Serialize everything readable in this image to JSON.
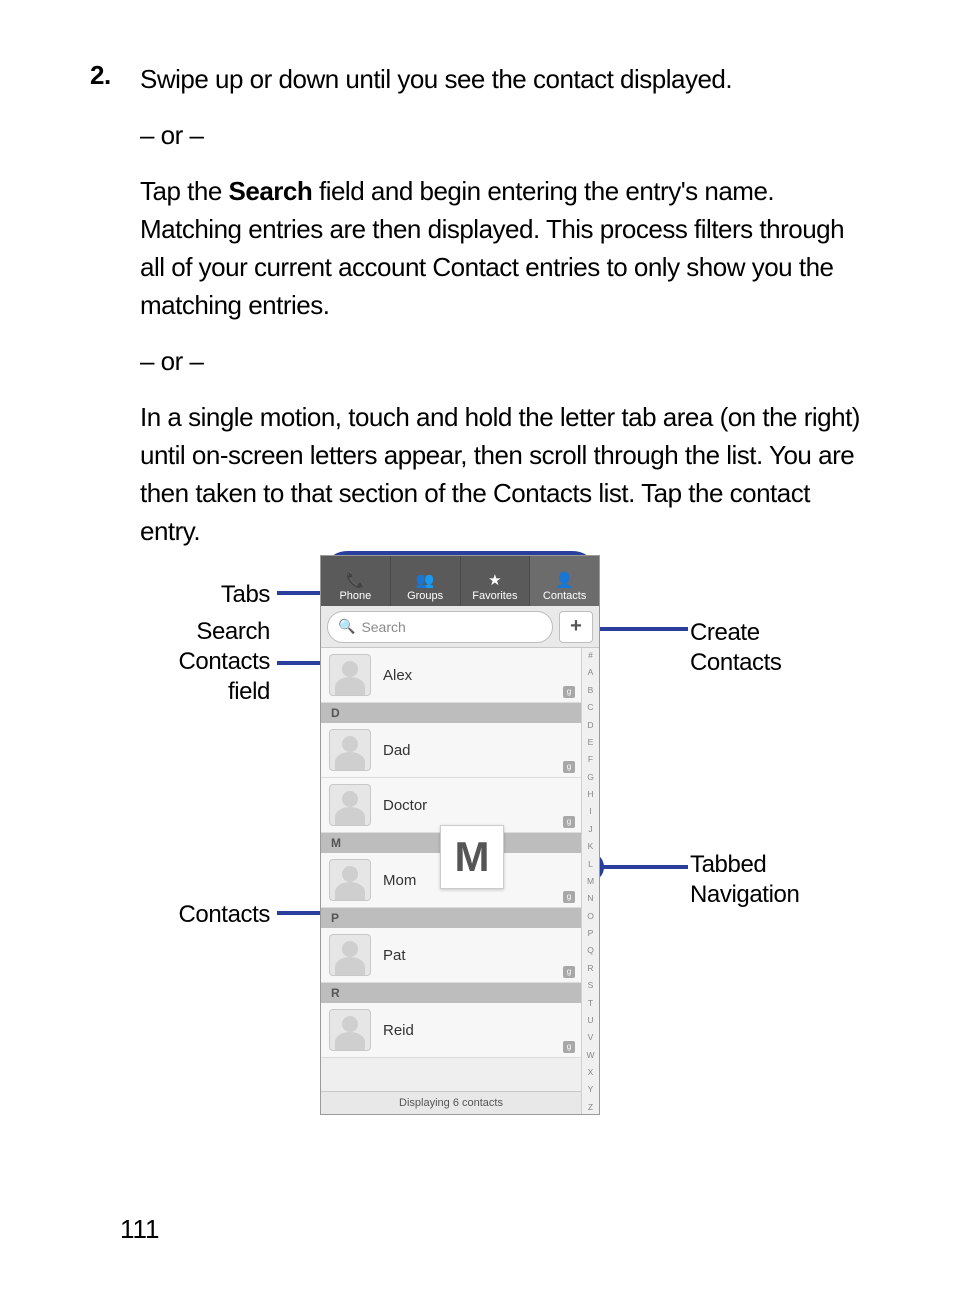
{
  "page_number": "111",
  "step": {
    "number": "2.",
    "p1_a": "Swipe up or down until you see the contact displayed.",
    "or1": "– or –",
    "p2_a": "Tap the ",
    "p2_bold": "Search",
    "p2_b": " field and begin entering the entry's name. Matching entries are then displayed. This process filters through all of your current account Contact entries to only show you the matching entries.",
    "or2": "– or –",
    "p3": "In a single motion, touch and hold the letter tab area (on the right) until on-screen letters appear, then scroll through the list. You are then taken to that section of the Contacts list. Tap the contact entry."
  },
  "callouts": {
    "tabs": "Tabs",
    "search_field_l1": "Search",
    "search_field_l2": "Contacts",
    "search_field_l3": "field",
    "contacts": "Contacts",
    "create_l1": "Create",
    "create_l2": "Contacts",
    "tabnav_l1": "Tabbed",
    "tabnav_l2": "Navigation"
  },
  "phone": {
    "tabs": [
      {
        "icon": "📞",
        "label": "Phone"
      },
      {
        "icon": "👥",
        "label": "Groups"
      },
      {
        "icon": "★",
        "label": "Favorites"
      },
      {
        "icon": "👤",
        "label": "Contacts"
      }
    ],
    "search_placeholder": "Search",
    "add_label": "+",
    "sections": [
      {
        "header": null,
        "rows": [
          "Alex"
        ]
      },
      {
        "header": "D",
        "rows": [
          "Dad",
          "Doctor"
        ]
      },
      {
        "header": "M",
        "rows": [
          "Mom"
        ]
      },
      {
        "header": "P",
        "rows": [
          "Pat"
        ]
      },
      {
        "header": "R",
        "rows": [
          "Reid"
        ]
      }
    ],
    "footer": "Displaying 6 contacts",
    "alphabet": [
      "#",
      "A",
      "B",
      "C",
      "D",
      "E",
      "F",
      "G",
      "H",
      "I",
      "J",
      "K",
      "L",
      "M",
      "N",
      "O",
      "P",
      "Q",
      "R",
      "S",
      "T",
      "U",
      "V",
      "W",
      "X",
      "Y",
      "Z"
    ],
    "popup_letter": "M"
  }
}
